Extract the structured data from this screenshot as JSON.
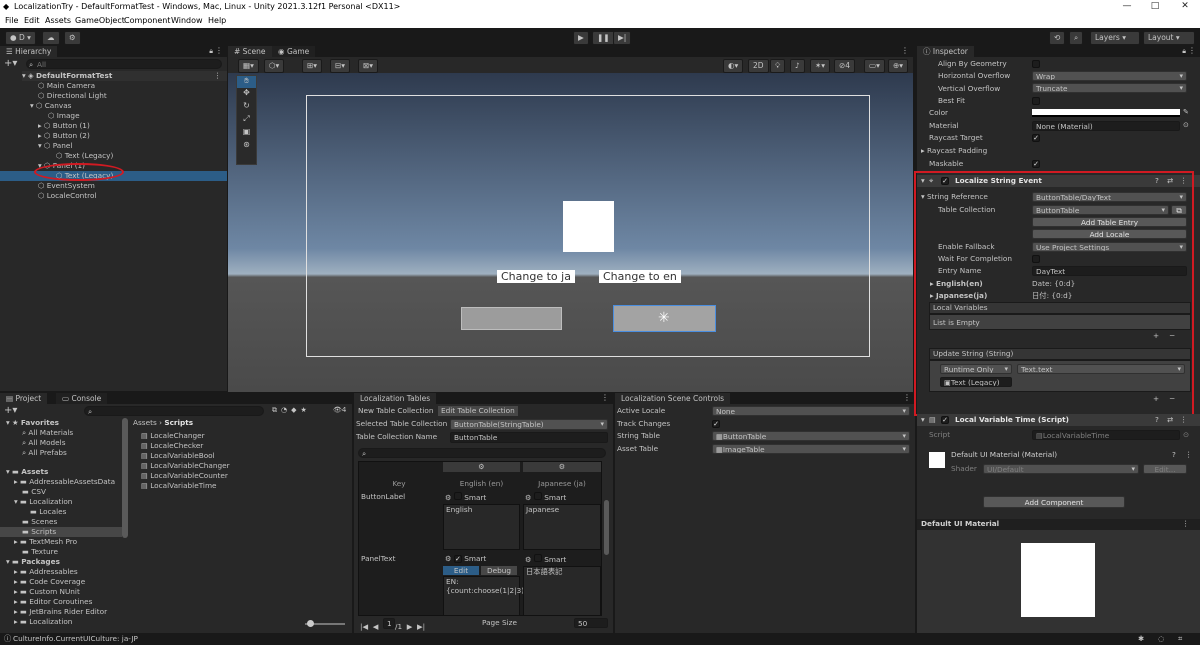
{
  "window": {
    "title": "LocalizationTry - DefaultFormatTest - Windows, Mac, Linux - Unity 2021.3.12f1 Personal <DX11>",
    "minimize": "—",
    "maximize": "□",
    "close": "✕"
  },
  "menu": [
    "File",
    "Edit",
    "Assets",
    "GameObject",
    "Component",
    "Window",
    "Help"
  ],
  "toolbar": {
    "account": "D",
    "layers": "Layers",
    "layout": "Layout",
    "play": "▶",
    "pause": "❚❚",
    "step": "▶|"
  },
  "hierarchy": {
    "tab": "Hierarchy",
    "search_placeholder": "All",
    "items": [
      {
        "label": "DefaultFormatTest"
      },
      {
        "label": "Main Camera"
      },
      {
        "label": "Directional Light"
      },
      {
        "label": "Canvas"
      },
      {
        "label": "Image"
      },
      {
        "label": "Button (1)"
      },
      {
        "label": "Button (2)"
      },
      {
        "label": "Panel"
      },
      {
        "label": "Text (Legacy)"
      },
      {
        "label": "Panel (1)"
      },
      {
        "label": "Text (Legacy)"
      },
      {
        "label": "EventSystem"
      },
      {
        "label": "LocaleControl"
      }
    ]
  },
  "scene": {
    "tab_scene": "Scene",
    "tab_game": "Game",
    "mode_2d": "2D",
    "btn_ja": "Change to ja",
    "btn_en": "Change to en",
    "gizmo_count": "4"
  },
  "project": {
    "tab_project": "Project",
    "tab_console": "Console",
    "favorites_header": "Favorites",
    "favorites": [
      "All Materials",
      "All Models",
      "All Prefabs"
    ],
    "assets_header": "Assets",
    "assets": [
      "AddressableAssetsData",
      "CSV",
      "Localization",
      "Locales",
      "Scenes",
      "Scripts",
      "TextMesh Pro",
      "Texture"
    ],
    "packages_header": "Packages",
    "packages": [
      "Addressables",
      "Code Coverage",
      "Custom NUnit",
      "Editor Coroutines",
      "JetBrains Rider Editor",
      "Localization"
    ],
    "breadcrumb_root": "Assets",
    "breadcrumb_sep": "›",
    "breadcrumb_leaf": "Scripts",
    "files": [
      "LocaleChanger",
      "LocaleChecker",
      "LocalVariableBool",
      "LocalVariableChanger",
      "LocalVariableCounter",
      "LocalVariableTime"
    ],
    "hidden_count": "4"
  },
  "loc_tables": {
    "tab": "Localization Tables",
    "new_btn": "New Table Collection",
    "edit_btn": "Edit Table Collection",
    "selected_label": "Selected Table Collection",
    "selected_value": "ButtonTable(StringTable)",
    "name_label": "Table Collection Name",
    "name_value": "ButtonTable",
    "col_key": "Key",
    "col_en": "English (en)",
    "col_ja": "Japanese (ja)",
    "smart": "Smart",
    "edit_tab": "Edit",
    "debug_tab": "Debug",
    "rows": [
      {
        "key": "ButtonLabel",
        "en": "English",
        "ja": "Japanese"
      },
      {
        "key": "PanelText",
        "en": "EN:{count:choose(1|2|3):One|Two|Three}",
        "ja": "日本語表記"
      }
    ],
    "page": "1",
    "pages": "/1",
    "page_size_label": "Page Size",
    "page_size": "50"
  },
  "scene_controls": {
    "tab": "Localization Scene Controls",
    "active_locale_label": "Active Locale",
    "active_locale": "None",
    "track_label": "Track Changes",
    "string_table_label": "String Table",
    "string_table": "ButtonTable",
    "asset_table_label": "Asset Table",
    "asset_table": "ImageTable"
  },
  "inspector": {
    "tab": "Inspector",
    "text_props": [
      {
        "label": "Align By Geometry",
        "value": ""
      },
      {
        "label": "Horizontal Overflow",
        "value": "Wrap"
      },
      {
        "label": "Vertical Overflow",
        "value": "Truncate"
      },
      {
        "label": "Best Fit",
        "value": ""
      }
    ],
    "color_label": "Color",
    "material_label": "Material",
    "material_value": "None (Material)",
    "raycast_target": "Raycast Target",
    "raycast_padding": "Raycast Padding",
    "maskable": "Maskable",
    "lse": {
      "title": "Localize String Event",
      "string_ref_label": "String Reference",
      "string_ref_value": "ButtonTable/DayText",
      "table_coll_label": "Table Collection",
      "table_coll_value": "ButtonTable",
      "add_entry": "Add Table Entry",
      "add_locale": "Add Locale",
      "fallback_label": "Enable Fallback",
      "fallback_value": "Use Project Settings",
      "wait_label": "Wait For Completion",
      "entry_name_label": "Entry Name",
      "entry_name_value": "DayText",
      "en_label": "English(en)",
      "en_value": "Date: {0:d}",
      "ja_label": "Japanese(ja)",
      "ja_value": "日付: {0:d}",
      "local_vars": "Local Variables",
      "list_empty": "List is Empty",
      "update_string": "Update String (String)",
      "runtime": "Runtime Only",
      "target_method": "Text.text",
      "target_obj": "Text (Legacy)",
      "plus": "+",
      "minus": "−"
    },
    "lvt": {
      "title": "Local Variable Time (Script)",
      "script_label": "Script",
      "script_value": "LocalVariableTime"
    },
    "mat": {
      "title": "Default UI Material (Material)",
      "shader_label": "Shader",
      "shader_value": "UI/Default",
      "edit_btn": "Edit..."
    },
    "add_component": "Add Component",
    "preview_header": "Default UI Material"
  },
  "status": {
    "text": "CultureInfo.CurrentUICulture: ja-JP"
  },
  "colors": {
    "accent": "#2c5d87",
    "highlight": "#d11a22"
  }
}
